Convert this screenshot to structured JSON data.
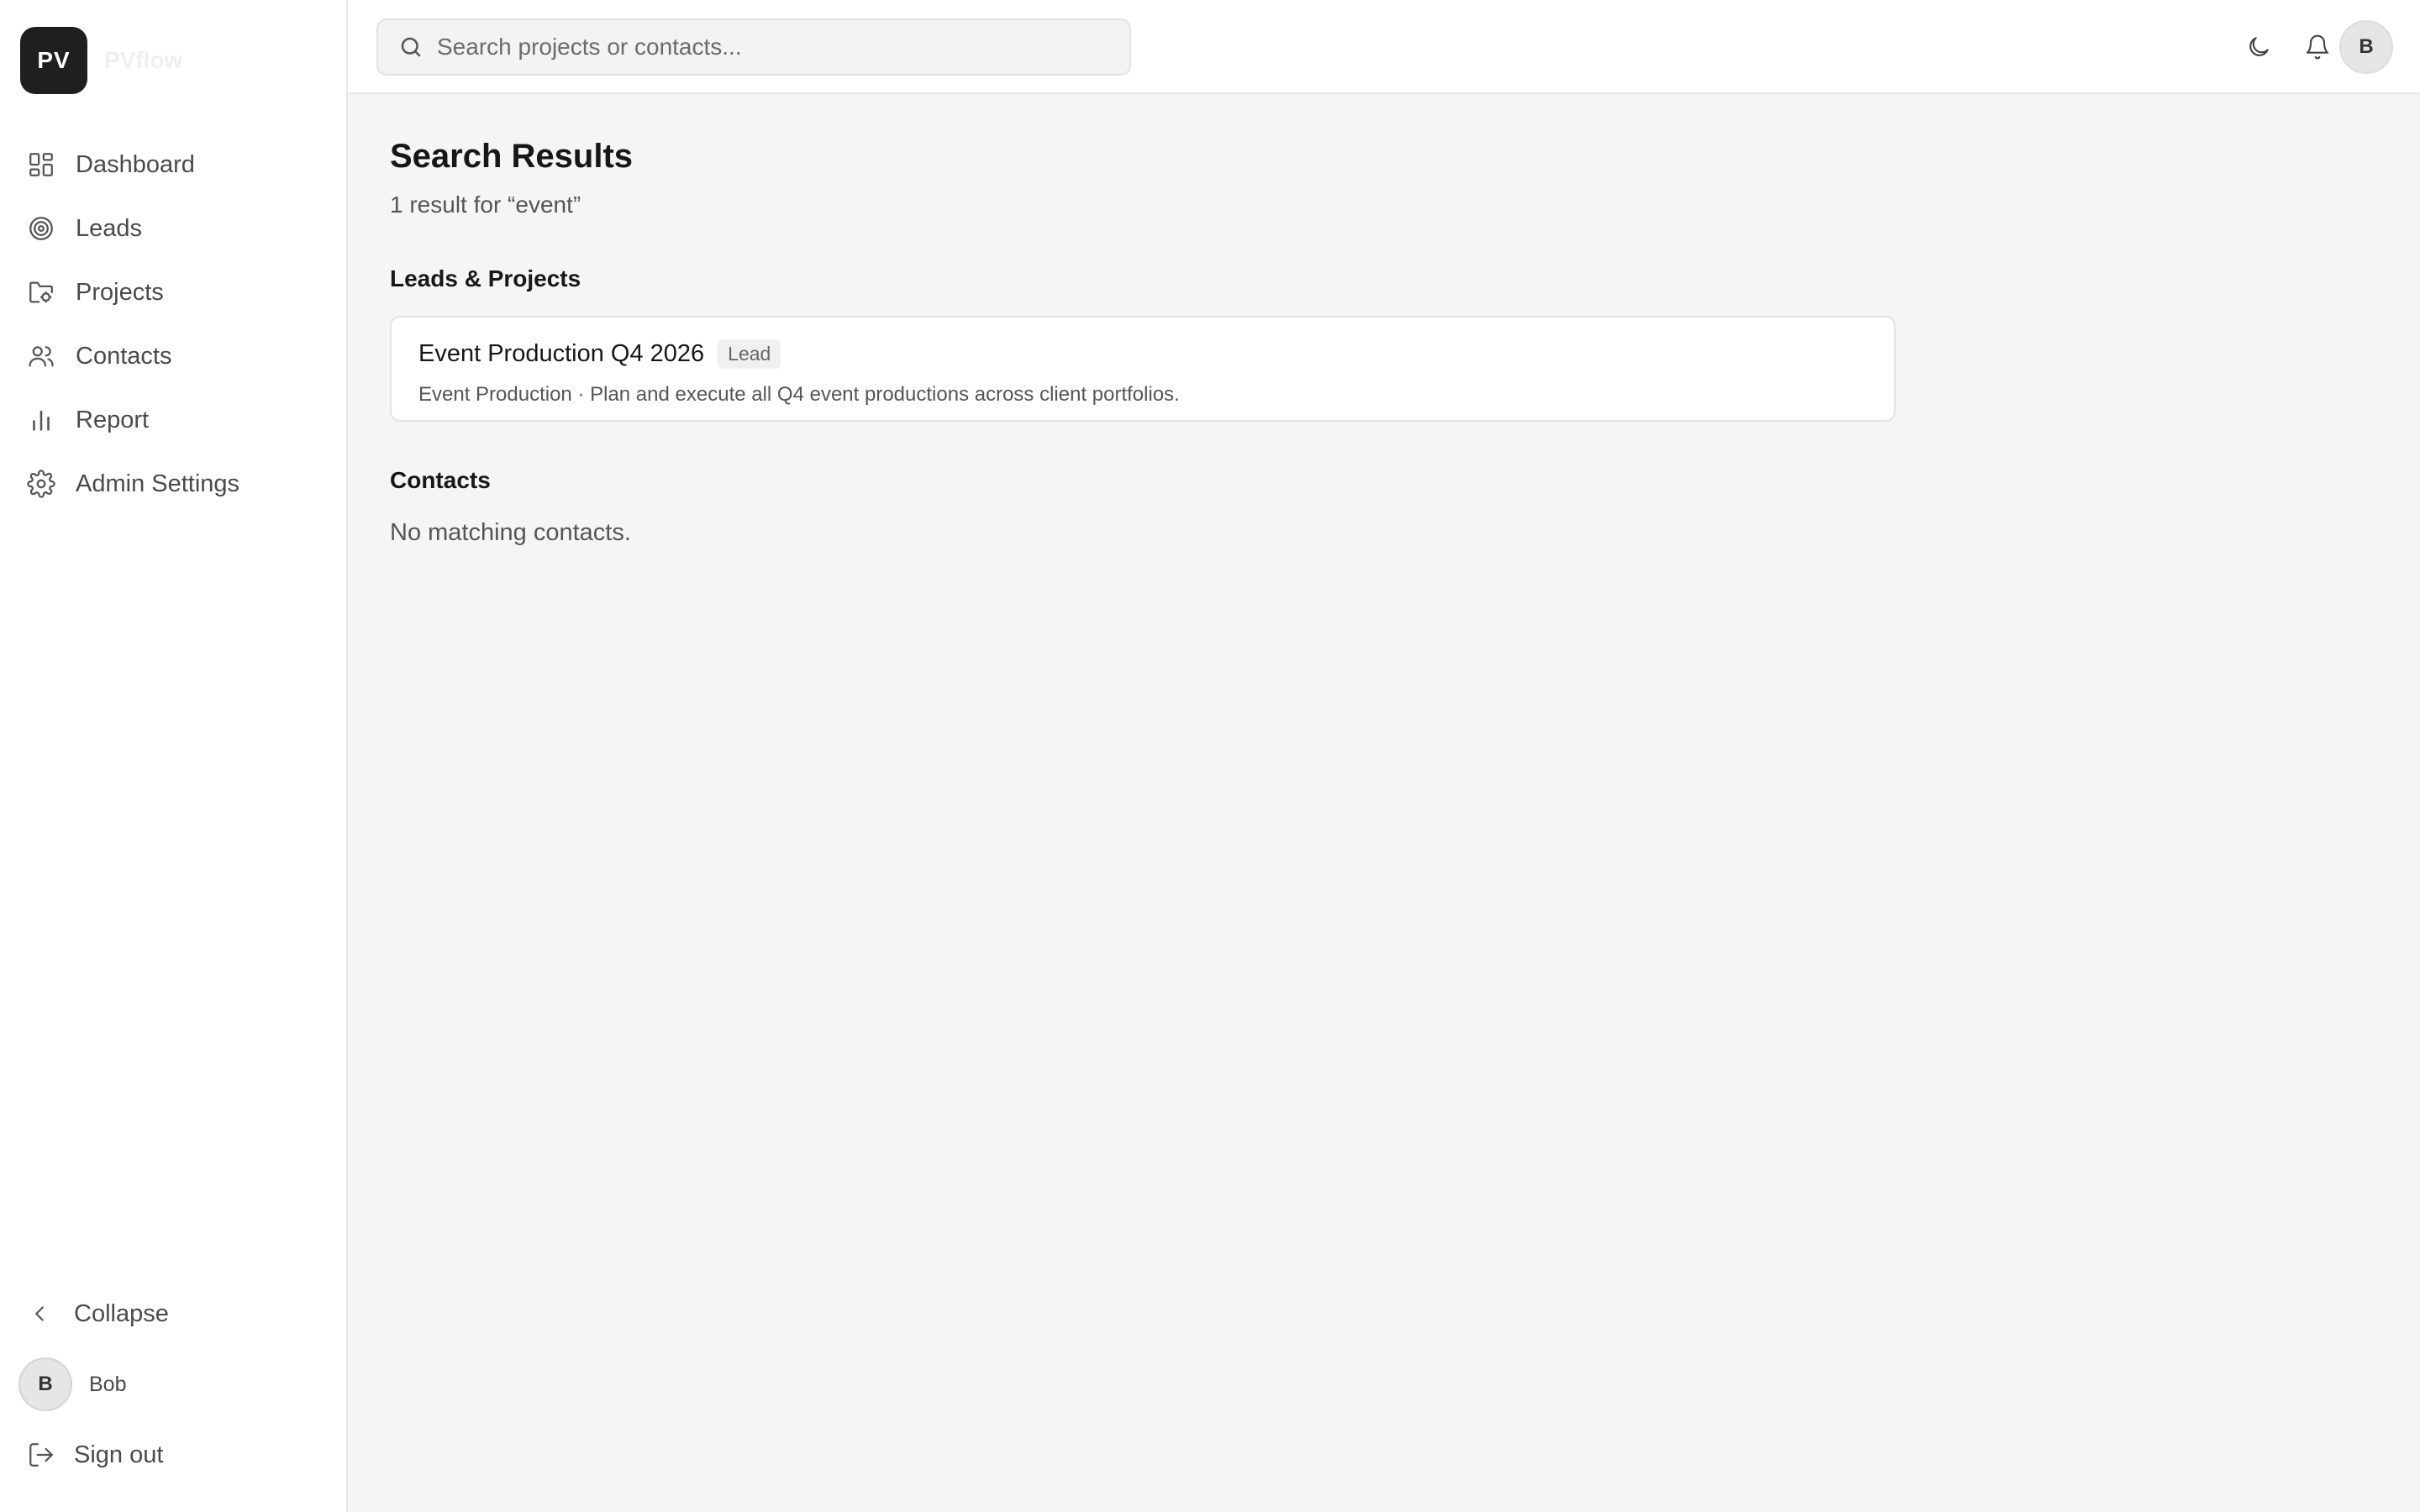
{
  "brand": {
    "logo_text": "PV",
    "name": "PVflow"
  },
  "sidebar": {
    "items": [
      {
        "label": "Dashboard",
        "icon": "dashboard-icon"
      },
      {
        "label": "Leads",
        "icon": "target-icon"
      },
      {
        "label": "Projects",
        "icon": "folder-icon"
      },
      {
        "label": "Contacts",
        "icon": "users-icon"
      },
      {
        "label": "Report",
        "icon": "bar-chart-icon"
      },
      {
        "label": "Admin Settings",
        "icon": "gear-icon"
      }
    ],
    "collapse_label": "Collapse",
    "user": {
      "initial": "B",
      "name": "Bob"
    },
    "signout_label": "Sign out"
  },
  "topbar": {
    "search_placeholder": "Search projects or contacts...",
    "user_initial": "B"
  },
  "main": {
    "title": "Search Results",
    "subtitle": "1 result for “event”",
    "leads_section_title": "Leads & Projects",
    "results": [
      {
        "title": "Event Production Q4 2026",
        "badge": "Lead",
        "description": "Event Production · Plan and execute all Q4 event productions across client portfolios."
      }
    ],
    "contacts_section_title": "Contacts",
    "contacts_empty": "No matching contacts."
  },
  "colors": {
    "logo_bg": "#1f1f1f",
    "page_bg": "#f5f5f5",
    "sidebar_bg": "#ffffff",
    "border": "#e6e6e6"
  }
}
